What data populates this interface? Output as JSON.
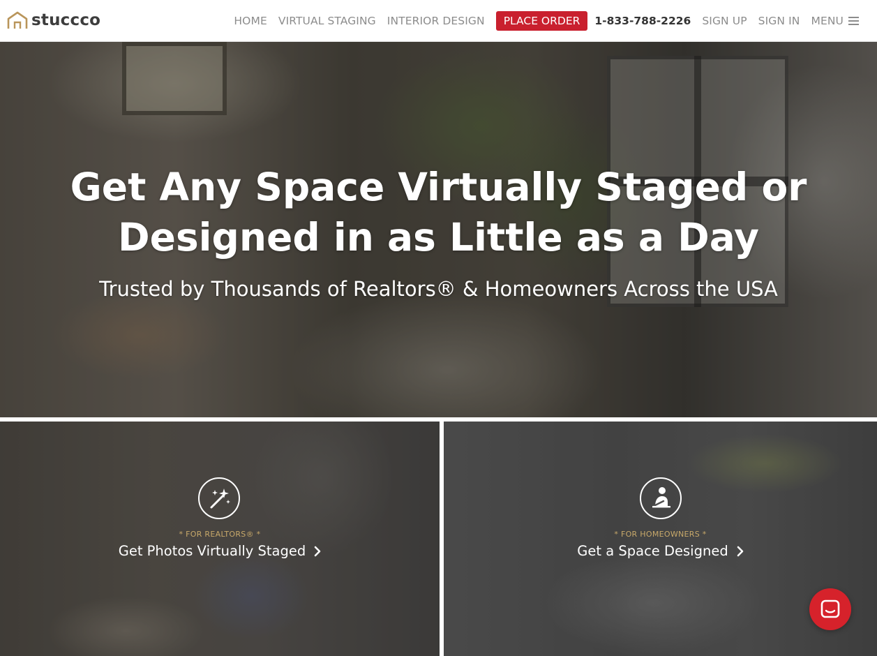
{
  "header": {
    "brand": "stuccco",
    "nav": {
      "home": "HOME",
      "virtual_staging": "VIRTUAL STAGING",
      "interior_design": "INTERIOR DESIGN",
      "place_order": "PLACE ORDER",
      "phone": "1-833-788-2226",
      "sign_up": "SIGN UP",
      "sign_in": "SIGN IN",
      "menu": "MENU"
    }
  },
  "hero": {
    "title_line1": "Get Any Space Virtually Staged or",
    "title_line2": "Designed in as Little as a Day",
    "subtitle": "Trusted by Thousands of Realtors® & Homeowners Across the USA"
  },
  "tiles": {
    "realtors": {
      "tag": "* FOR REALTORS® *",
      "cta": "Get Photos Virtually Staged",
      "icon": "magic-wand-icon"
    },
    "homeowners": {
      "tag": "* FOR HOMEOWNERS *",
      "cta": "Get a Space Designed",
      "icon": "designer-person-icon"
    }
  },
  "chat": {
    "icon": "chat-icon"
  },
  "colors": {
    "accent": "#c9202e",
    "tag_gold": "#c8a96a",
    "nav_gray": "#8c8c8c"
  }
}
